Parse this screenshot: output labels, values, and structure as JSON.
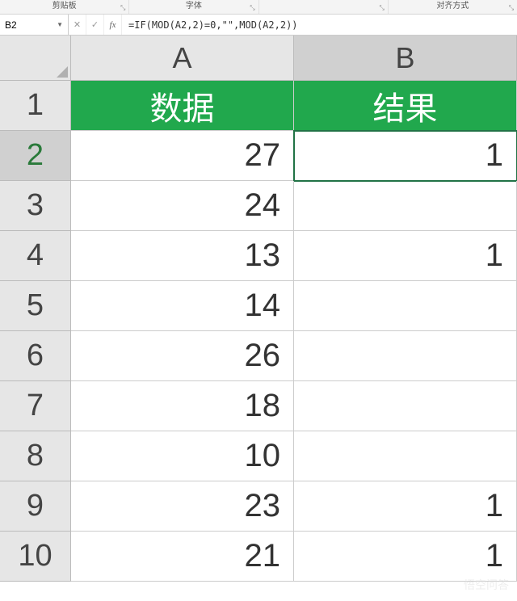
{
  "ribbon": {
    "sections": [
      "剪贴板",
      "字体",
      "",
      "对齐方式"
    ]
  },
  "formula_bar": {
    "name_box": "B2",
    "cancel": "✕",
    "enter": "✓",
    "fx": "fx",
    "formula": "=IF(MOD(A2,2)=0,\"\",MOD(A2,2))"
  },
  "columns": [
    "A",
    "B"
  ],
  "header_row": {
    "num": "1",
    "cells": [
      "数据",
      "结果"
    ]
  },
  "rows": [
    {
      "num": "2",
      "a": "27",
      "b": "1",
      "active": true
    },
    {
      "num": "3",
      "a": "24",
      "b": ""
    },
    {
      "num": "4",
      "a": "13",
      "b": "1"
    },
    {
      "num": "5",
      "a": "14",
      "b": ""
    },
    {
      "num": "6",
      "a": "26",
      "b": ""
    },
    {
      "num": "7",
      "a": "18",
      "b": ""
    },
    {
      "num": "8",
      "a": "10",
      "b": ""
    },
    {
      "num": "9",
      "a": "23",
      "b": "1"
    },
    {
      "num": "10",
      "a": "21",
      "b": "1"
    }
  ],
  "watermark": "悟空问答"
}
